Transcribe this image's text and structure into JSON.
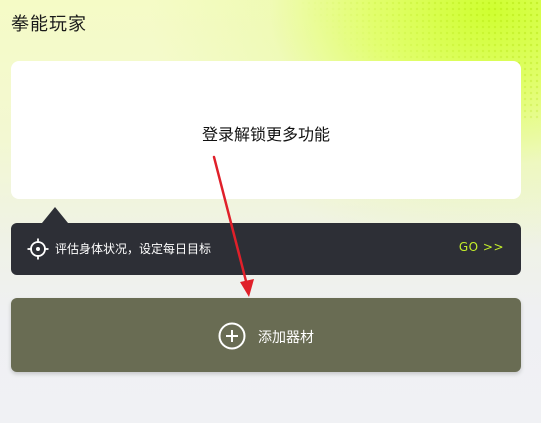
{
  "header": {
    "title": "拳能玩家"
  },
  "login_card": {
    "text": "登录解锁更多功能"
  },
  "tip_bar": {
    "text": "评估身体状况，设定每日目标",
    "go_label": "GO >>",
    "icon": "target-icon"
  },
  "add_equipment": {
    "label": "添加器材",
    "icon": "plus-circle-icon"
  },
  "colors": {
    "accent_green": "#c4ef2b",
    "tip_bar_bg": "#2d2f36",
    "add_button_bg": "#696c53",
    "annotation_red": "#e0202a"
  }
}
